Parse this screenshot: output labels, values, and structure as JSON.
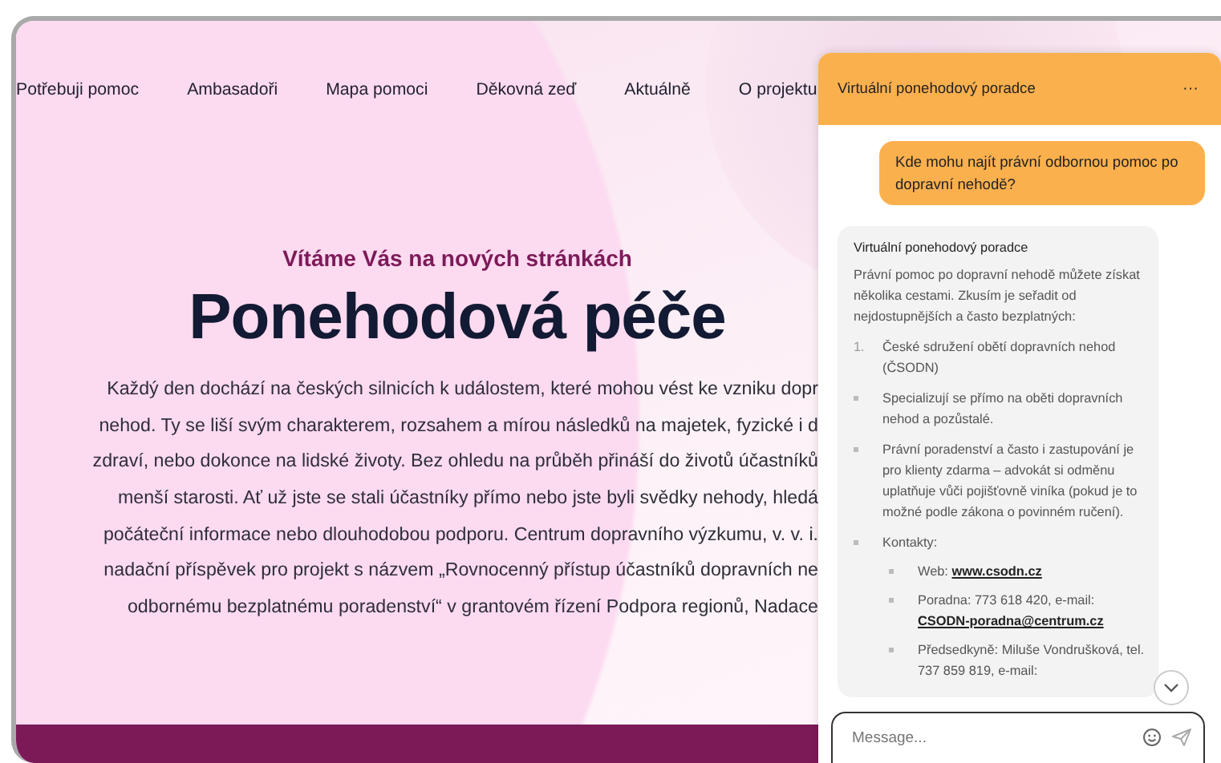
{
  "nav": [
    {
      "label": "Potřebuji pomoc"
    },
    {
      "label": "Ambasadoři"
    },
    {
      "label": "Mapa pomoci"
    },
    {
      "label": "Děkovná zeď"
    },
    {
      "label": "Aktuálně"
    },
    {
      "label": "O projektu"
    }
  ],
  "hero": {
    "kicker": "Vítáme Vás na nových stránkách",
    "title": "Ponehodová péče",
    "lines": [
      "Každý den dochází na českých silnicích k událostem, které mohou vést ke vzniku dopr",
      "nehod. Ty se liší svým charakterem, rozsahem a mírou následků na majetek, fyzické i d",
      "zdraví, nebo dokonce na lidské životy. Bez ohledu na průběh přináší do životů účastníků",
      "menší starosti. Ať už jste se stali účastníky přímo nebo jste byli svědky nehody, hledá",
      "počáteční informace nebo dlouhodobou podporu. Centrum dopravního výzkumu, v. v. i.",
      "nadační příspěvek pro projekt s názvem „Rovnocenný přístup účastníků dopravních ne",
      "odbornému bezplatnému poradenství“ v grantovém řízení Podpora regionů, Nadace"
    ]
  },
  "chat": {
    "title": "Virtuální ponehodový poradce",
    "menu": "···",
    "user_message": "Kde mohu najít právní odbornou pomoc po dopravní nehodě?",
    "bot_message": {
      "sender": "Virtuální ponehodový poradce",
      "intro": "Právní pomoc po dopravní nehodě můžete získat několika cestami. Zkusím je seřadit od nejdostupnějších a často bezplatných:",
      "blocks": [
        {
          "kind": "numbered",
          "marker": "1.",
          "text": "České sdružení obětí dopravních nehod (ČSODN)"
        },
        {
          "kind": "bullet",
          "text": "Specializují se přímo na oběti dopravních nehod a pozůstalé."
        },
        {
          "kind": "bullet",
          "text": "Právní poradenství a často i zastupování je pro klienty zdarma – advokát si odměnu uplatňuje vůči pojišťovně viníka (pokud je to možné podle zákona o povinném ručení)."
        },
        {
          "kind": "bullet",
          "text": "Kontakty:",
          "children": [
            {
              "text": "Web:",
              "link": "www.csodn.cz"
            },
            {
              "text": "Poradna: 773 618 420, e-mail:",
              "link": "CSODN-poradna@centrum.cz"
            },
            {
              "text": "Předsedkyně: Miluše Vondrušková, tel. 737 859 819, e-mail:"
            }
          ]
        }
      ]
    },
    "input": {
      "placeholder": "Message..."
    }
  }
}
